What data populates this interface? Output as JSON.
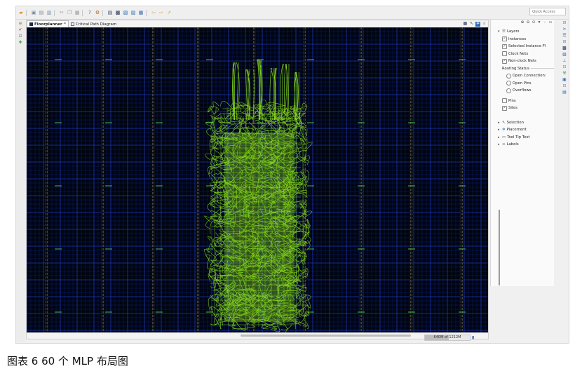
{
  "toolbar": {
    "icons": [
      "open-icon",
      "save-icon",
      "save-all-icon",
      "cut-icon",
      "copy-icon",
      "paste-icon",
      "undo-icon",
      "redo-icon",
      "help-icon",
      "settings-icon",
      "layout-icon",
      "floorplan-icon",
      "schematic-icon",
      "device-icon",
      "report-icon",
      "back-icon",
      "forward-icon",
      "run-icon"
    ],
    "quick_access_placeholder": "Quick Access"
  },
  "tabs": [
    {
      "label": "Floorplanner",
      "close": "⌗",
      "active": true
    },
    {
      "label": "Critical Path Diagram",
      "close": "",
      "active": false
    }
  ],
  "layers": {
    "title": "Layers",
    "instances": "Instances",
    "selected_instance": "Selected Instance Fl",
    "clock_nets": "Clock Nets",
    "non_clock_nets": "Non-clock Nets",
    "routing_status": "Routing Status",
    "open_connections": "Open Connection:",
    "open_pins": "Open Pins",
    "overflows": "Overflows",
    "pins": "Pins",
    "sites": "Sites"
  },
  "sections": {
    "selection": "Selection",
    "placement": "Placement",
    "tooltip": "Tool Tip Text",
    "labels": "Labels"
  },
  "status": {
    "heap": "640M of 1212M",
    "heap_fraction": 0.53
  },
  "caption": "图表 6 60 个 MLP 布局图",
  "colors": {
    "canvas_bg": "#000510",
    "grid_major": "#1f3fd1",
    "grid_minor": "#0e1f7a",
    "site_column": "#5a5a5a",
    "net_lime": "#8be21a",
    "clock_marker": "#3fbf3f"
  }
}
